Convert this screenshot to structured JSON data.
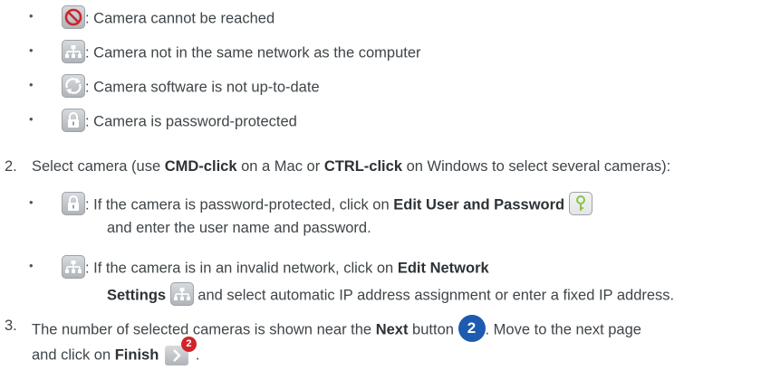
{
  "status_icons": [
    {
      "icon": "no-entry-icon",
      "text": ": Camera cannot be reached"
    },
    {
      "icon": "network-icon",
      "text": ": Camera not in the same network as the computer"
    },
    {
      "icon": "refresh-icon",
      "text": ": Camera software is not up-to-date"
    },
    {
      "icon": "lock-icon",
      "text": ": Camera is password-protected"
    }
  ],
  "step2": {
    "num": "2.",
    "t1": "Select camera (use ",
    "b1": "CMD-click",
    "t2": " on a Mac or ",
    "b2": "CTRL-click",
    "t3": " on Windows to select several cameras):",
    "sub1": {
      "t1": ": If the camera is password-protected, click on ",
      "b1": "Edit User and Password",
      "t2": "and enter the user name and password."
    },
    "sub2": {
      "t1": ": If the camera is in an invalid network, click on ",
      "b1": "Edit Network",
      "b2": "Settings",
      "t2": " and select automatic IP address assignment or enter a fixed IP address."
    }
  },
  "step3": {
    "num": "3.",
    "t1": "The number of selected cameras is shown near the ",
    "b1": "Next",
    "t2": " button ",
    "badge": "2",
    "t3": ". Move to the next page",
    "t4": "and click on ",
    "b2": "Finish",
    "finish_badge": "2",
    "t5": "."
  },
  "colors": {
    "accent_blue": "#1d5bb0",
    "badge_red": "#d0242a",
    "text": "#3f4549"
  }
}
